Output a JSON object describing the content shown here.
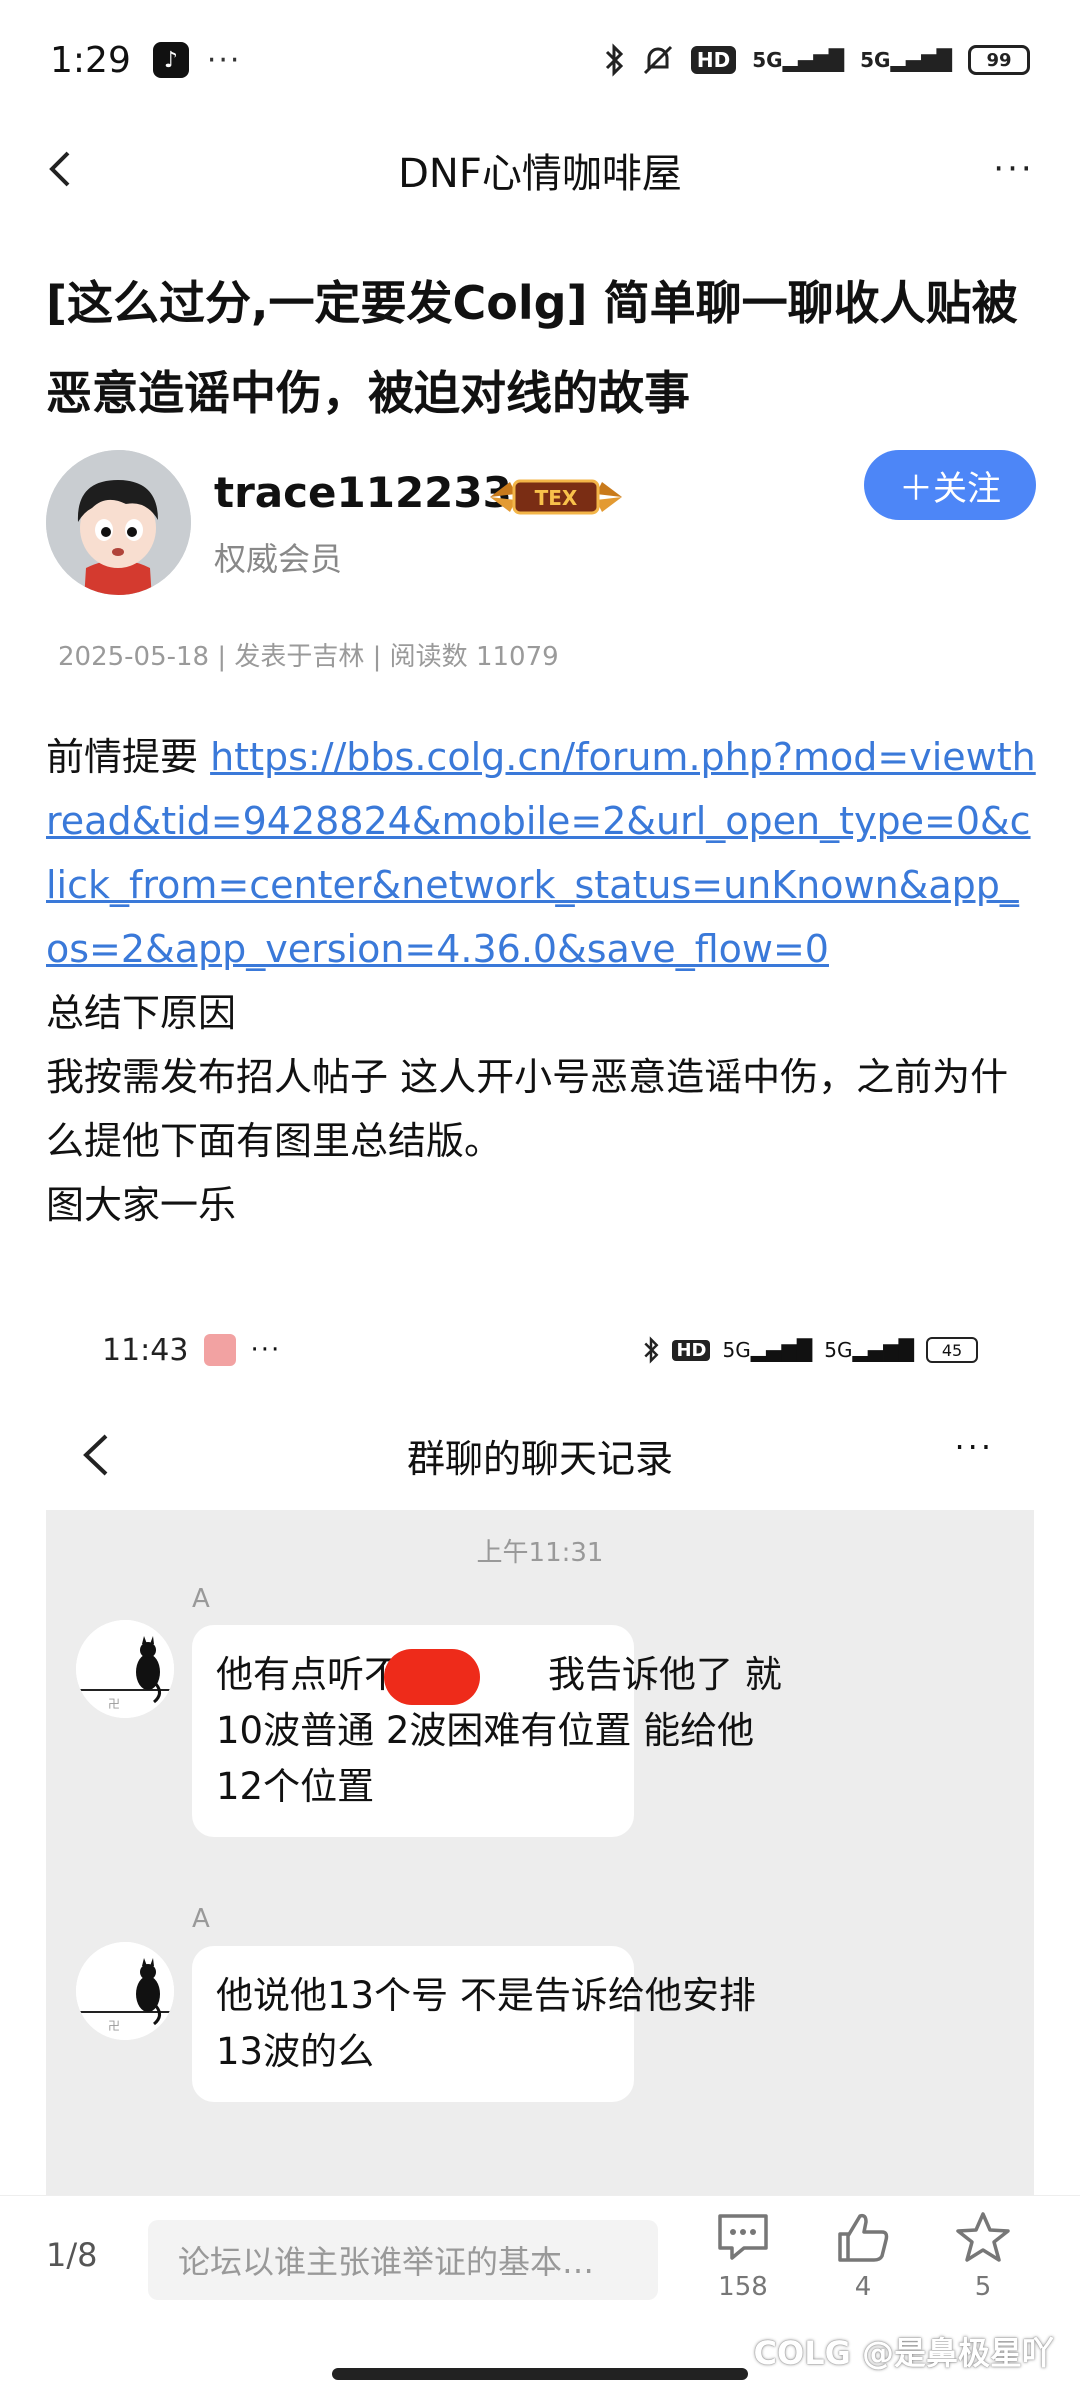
{
  "status_bar": {
    "time": "1:29",
    "dots": "···",
    "hd": "HD",
    "signal1": "5G",
    "signal2": "5G",
    "battery": "99"
  },
  "header": {
    "title": "DNF心情咖啡屋",
    "more": "···"
  },
  "post": {
    "title": "[这么过分,一定要发Colg] 简单聊一聊收人贴被恶意造谣中伤，被迫对线的故事",
    "author": {
      "name": "trace112233",
      "role": "权威会员",
      "badge_text": "TEX",
      "follow_label": "＋关注"
    },
    "meta": "2025-05-18 | 发表于吉林 | 阅读数 11079",
    "intro_label": "前情提要 ",
    "link": "https://bbs.colg.cn/forum.php?mod=viewthread&tid=9428824&mobile=2&url_open_type=0&click_from=center&network_status=unKnown&app_os=2&app_version=4.36.0&save_flow=0",
    "paragraphs": [
      "总结下原因",
      "我按需发布招人帖子 这人开小号恶意造谣中伤，之前为什么提他下面有图里总结版。",
      "图大家一乐"
    ]
  },
  "embed": {
    "status_time": "11:43",
    "status_dots": "···",
    "hd": "HD",
    "signal1": "5G",
    "signal2": "5G",
    "battery": "45",
    "title": "群聊的聊天记录",
    "more": "···",
    "chat_time": "上午11:31",
    "messages": [
      {
        "sender": "A",
        "text_before": "他有点听不懂",
        "text_after": "我告诉他了 就",
        "line2": "10波普通 2波困难有位置 能给他",
        "line3": "12个位置"
      },
      {
        "sender": "A",
        "line1": "他说他13个号 不是告诉给他安排",
        "line2": "13波的么"
      }
    ]
  },
  "bottom_bar": {
    "page": "1/8",
    "input_placeholder": "论坛以谁主张谁举证的基本…",
    "comments": "158",
    "likes": "4",
    "favorites": "5"
  },
  "watermark": "COLG @是鼻极星吖",
  "colors": {
    "accent": "#4d86f7",
    "link": "#3a79d9",
    "chat_bg": "#ededed"
  }
}
